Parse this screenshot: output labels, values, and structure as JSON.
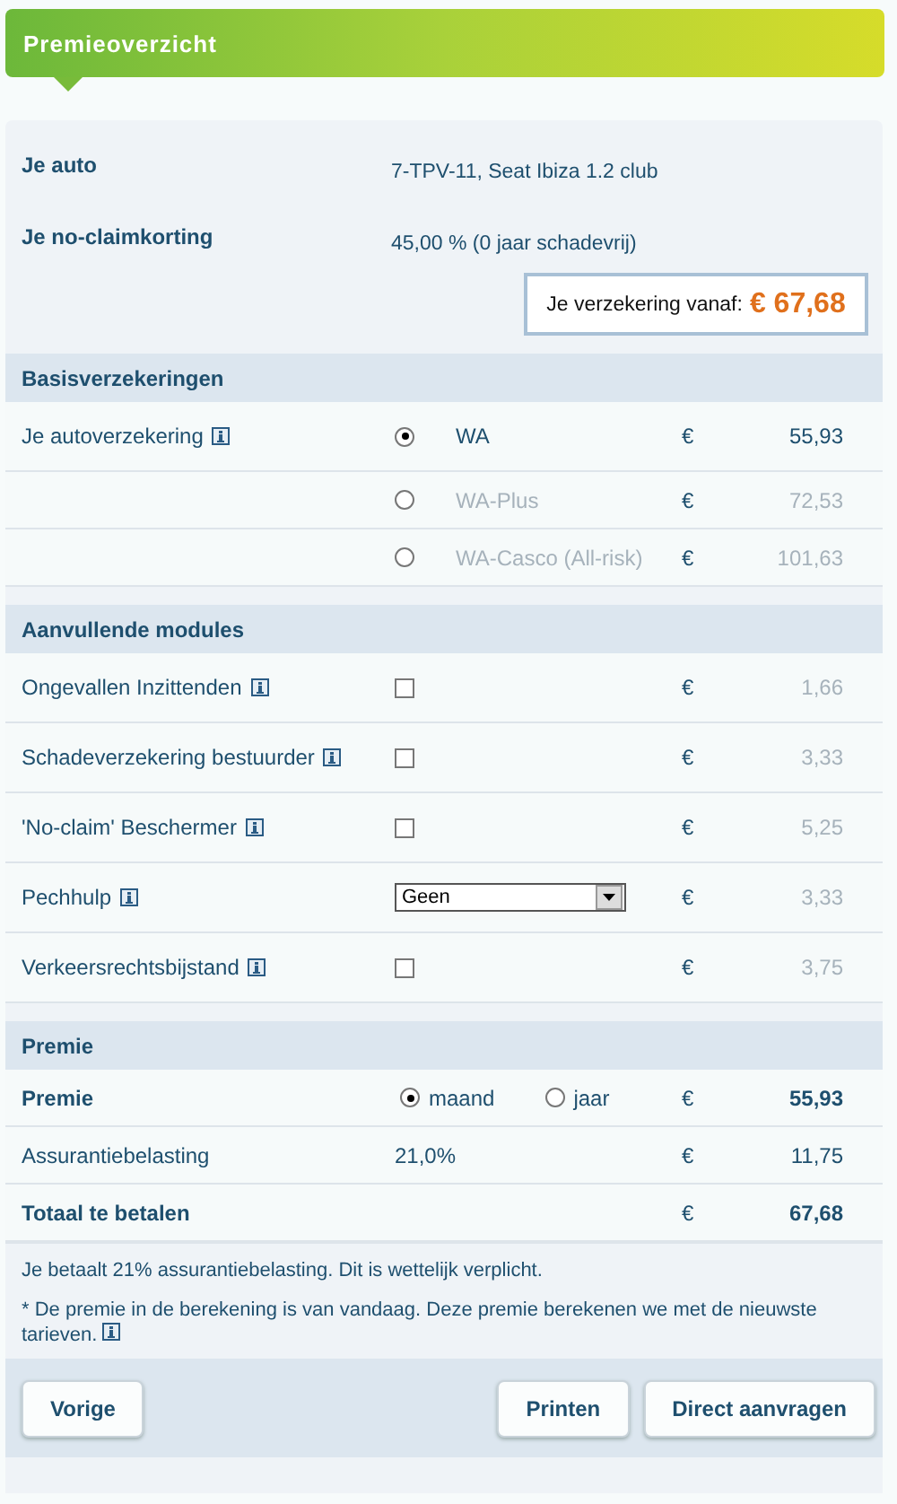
{
  "header": {
    "title": "Premieoverzicht"
  },
  "summary": {
    "rows": [
      {
        "label": "Je auto",
        "value": "7-TPV-11, Seat Ibiza 1.2 club"
      },
      {
        "label": "Je no-claimkorting",
        "value": "45,00 % (0 jaar schadevrij)"
      }
    ],
    "price_box": {
      "label": "Je verzekering vanaf:",
      "amount": "€ 67,68"
    }
  },
  "basis": {
    "title": "Basisverzekeringen",
    "label": "Je autoverzekering",
    "options": [
      {
        "option": "WA",
        "currency": "€",
        "price": "55,93",
        "selected": true
      },
      {
        "option": "WA-Plus",
        "currency": "€",
        "price": "72,53",
        "selected": false
      },
      {
        "option": "WA-Casco (All-risk)",
        "currency": "€",
        "price": "101,63",
        "selected": false
      }
    ]
  },
  "modules": {
    "title": "Aanvullende modules",
    "rows": [
      {
        "kind": "checkbox",
        "label": "Ongevallen Inzittenden",
        "checked": false,
        "currency": "€",
        "price": "1,66"
      },
      {
        "kind": "checkbox",
        "label": "Schadeverzekering bestuurder",
        "checked": false,
        "currency": "€",
        "price": "3,33"
      },
      {
        "kind": "checkbox",
        "label": "'No-claim' Beschermer",
        "checked": false,
        "currency": "€",
        "price": "5,25"
      },
      {
        "kind": "select",
        "label": "Pechhulp",
        "value": "Geen",
        "included": false,
        "currency": "€",
        "price": "3,33"
      },
      {
        "kind": "checkbox",
        "label": "Verkeersrechtsbijstand",
        "checked": false,
        "currency": "€",
        "price": "3,75"
      }
    ]
  },
  "premie": {
    "title": "Premie",
    "rows": [
      {
        "kind": "period",
        "label": "Premie",
        "periods": [
          {
            "label": "maand",
            "selected": true
          },
          {
            "label": "jaar",
            "selected": false
          }
        ],
        "currency": "€",
        "amount": "55,93"
      },
      {
        "kind": "rate",
        "label": "Assurantiebelasting",
        "rate": "21,0%",
        "currency": "€",
        "amount": "11,75"
      },
      {
        "kind": "total",
        "label": "Totaal te betalen",
        "currency": "€",
        "amount": "67,68"
      }
    ]
  },
  "notes": [
    "Je betaalt 21% assurantiebelasting. Dit is wettelijk verplicht.",
    "* De premie in de berekening is van vandaag. Deze premie berekenen we met de nieuwste tarieven."
  ],
  "buttons": {
    "back": "Vorige",
    "actions": [
      "Printen",
      "Direct aanvragen"
    ]
  }
}
